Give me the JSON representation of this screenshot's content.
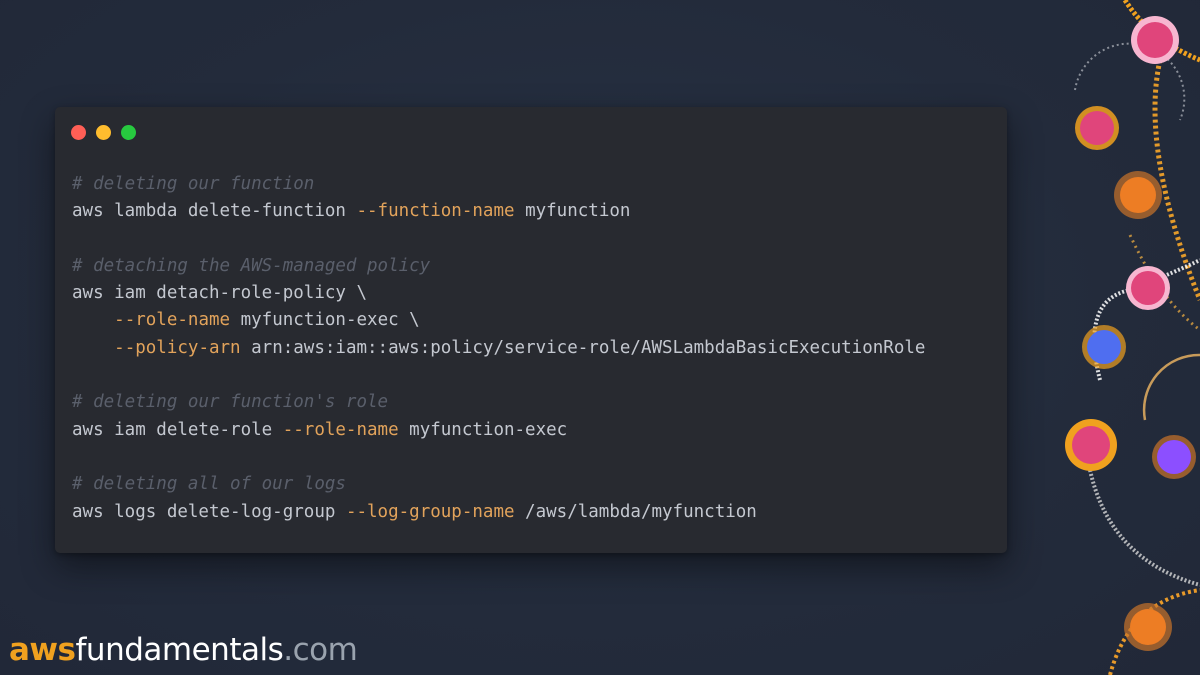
{
  "window": {
    "controls": [
      {
        "name": "close",
        "color": "#ff5f56"
      },
      {
        "name": "minimize",
        "color": "#ffbd2e"
      },
      {
        "name": "maximize",
        "color": "#27c93f"
      }
    ]
  },
  "code": {
    "lines": [
      {
        "comment": "# deleting our function"
      },
      {
        "cmd": "aws lambda delete-function ",
        "flag": "--function-name",
        "arg": " myfunction"
      },
      {
        "blank": true
      },
      {
        "comment": "# detaching the AWS-managed policy"
      },
      {
        "cmd": "aws iam detach-role-policy \\"
      },
      {
        "indent": "    ",
        "flag": "--role-name",
        "arg": " myfunction-exec \\"
      },
      {
        "indent": "    ",
        "flag": "--policy-arn",
        "arg": " arn:aws:iam::aws:policy/service-role/AWSLambdaBasicExecutionRole"
      },
      {
        "blank": true
      },
      {
        "comment": "# deleting our function's role"
      },
      {
        "cmd": "aws iam delete-role ",
        "flag": "--role-name",
        "arg": " myfunction-exec"
      },
      {
        "blank": true
      },
      {
        "comment": "# deleting all of our logs"
      },
      {
        "cmd": "aws logs delete-log-group ",
        "flag": "--log-group-name",
        "arg": " /aws/lambda/myfunction"
      }
    ]
  },
  "brand": {
    "aws": "aws",
    "name": "fundamentals",
    "tld": ".com"
  },
  "decoration": {
    "icons": [
      {
        "icon": "api-gateway-icon",
        "color": "#e0457b"
      },
      {
        "icon": "eventbridge-icon",
        "color": "#e0457b"
      },
      {
        "icon": "lambda-icon",
        "color": "#ed7d24"
      },
      {
        "icon": "step-functions-icon",
        "color": "#e0457b"
      },
      {
        "icon": "elastic-beanstalk-icon",
        "color": "#4f6ef0"
      },
      {
        "icon": "sqs-icon",
        "color": "#e0457b"
      },
      {
        "icon": "cloudfront-icon",
        "color": "#8c4fff"
      },
      {
        "icon": "sagemaker-icon",
        "color": "#ed7d24"
      }
    ]
  }
}
